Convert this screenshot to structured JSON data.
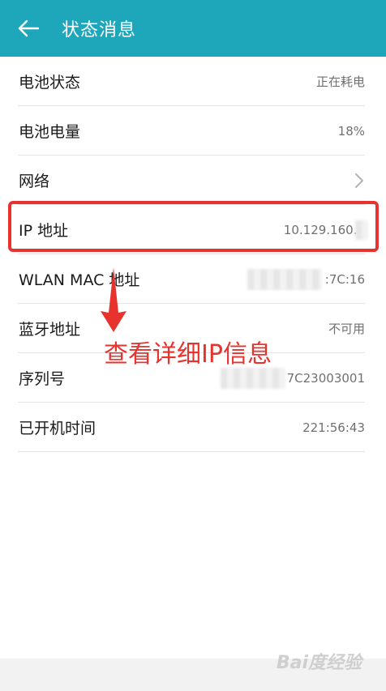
{
  "header": {
    "title": "状态消息"
  },
  "rows": [
    {
      "label": "电池状态",
      "value": "正在耗电"
    },
    {
      "label": "电池电量",
      "value": "18%"
    },
    {
      "label": "网络",
      "value": ""
    },
    {
      "label": "IP 地址",
      "value": "10.129.160.1"
    },
    {
      "label": "WLAN MAC 地址",
      "value": ":7C:16"
    },
    {
      "label": "蓝牙地址",
      "value": "不可用"
    },
    {
      "label": "序列号",
      "value": "7C23003001"
    },
    {
      "label": "已开机时间",
      "value": "221:56:43"
    }
  ],
  "annotation": {
    "text": "查看详细IP信息",
    "color": "#e8322d"
  },
  "watermark": "Bai度经验",
  "colors": {
    "header": "#1ea6bb",
    "divider": "#e4e4e4"
  }
}
